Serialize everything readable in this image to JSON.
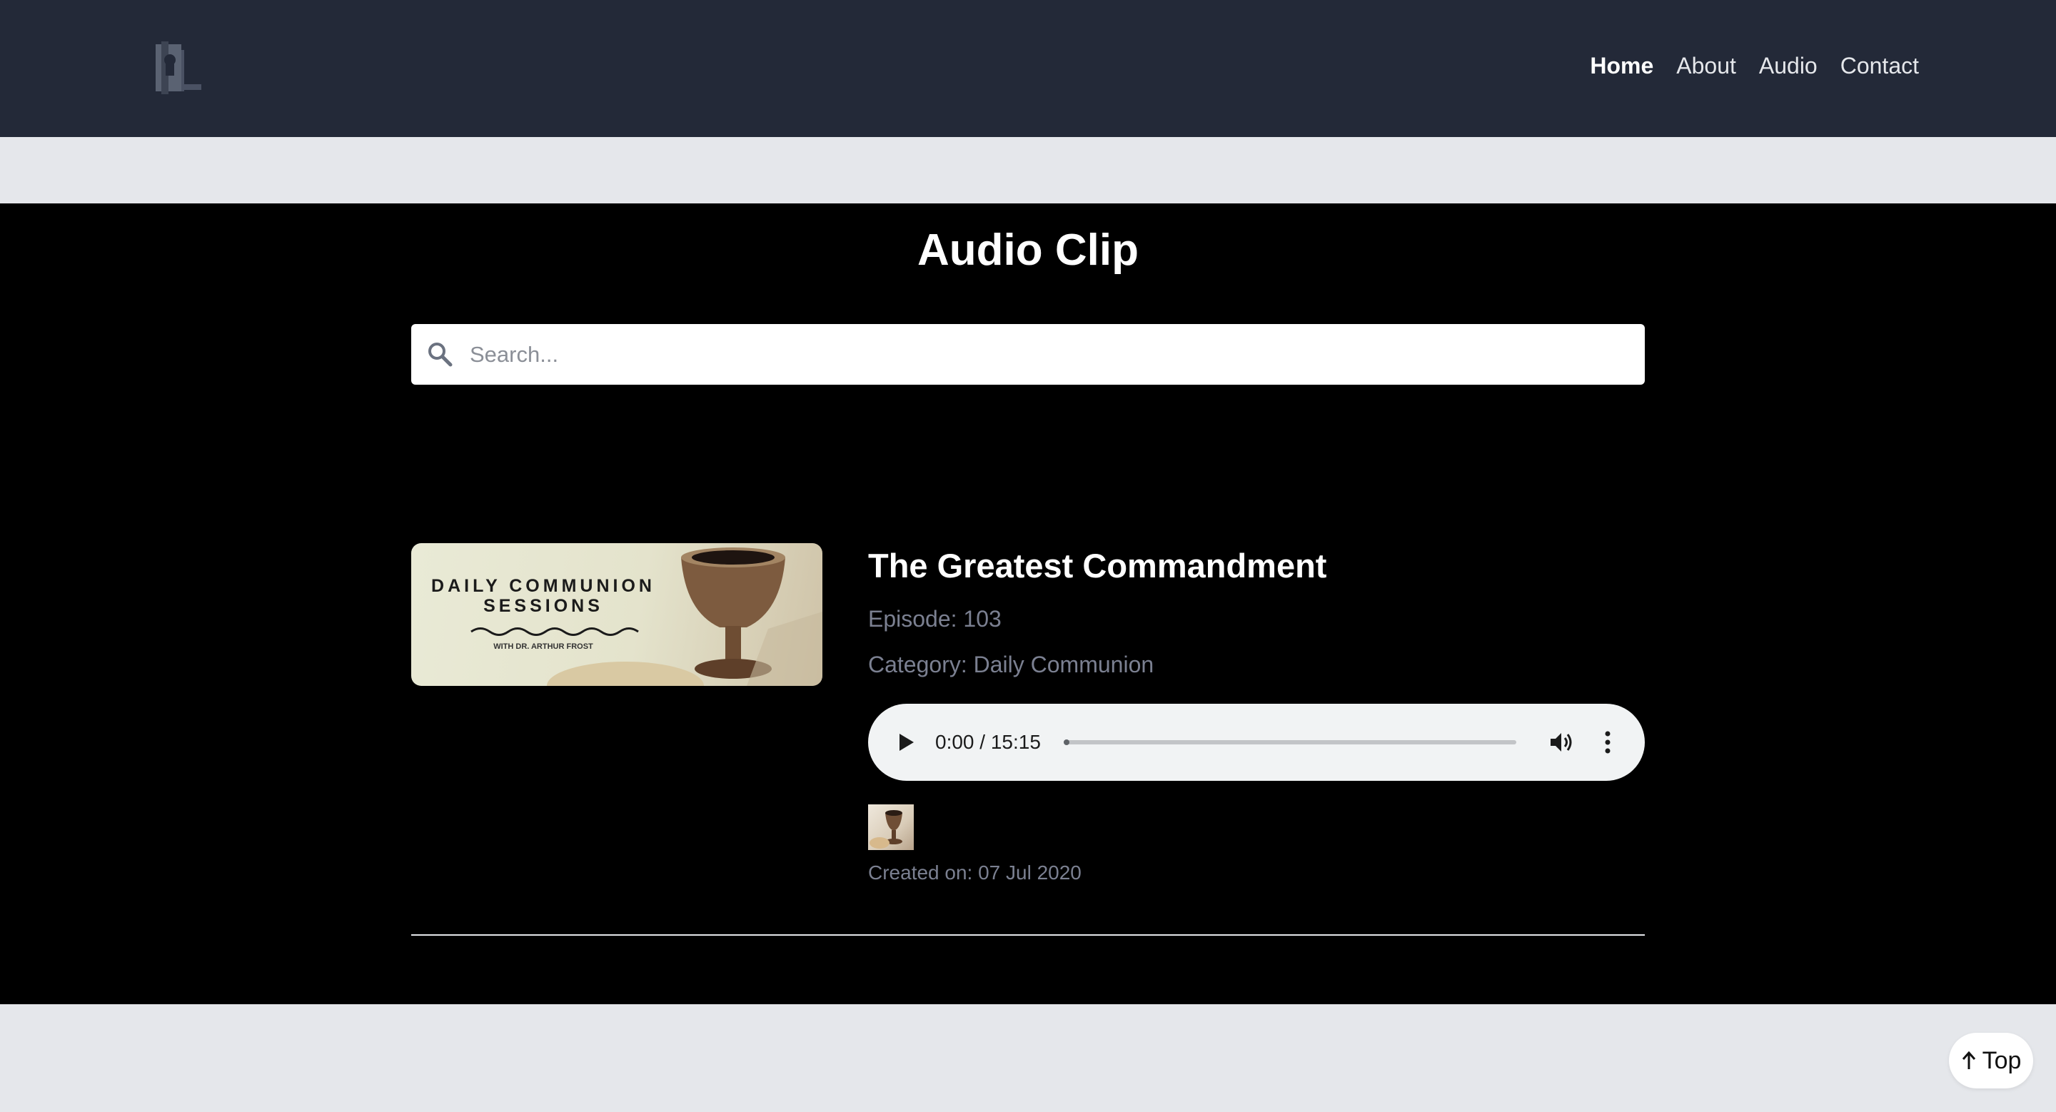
{
  "nav": {
    "logo_icon": "site-logo",
    "links": [
      {
        "label": "Home",
        "active": true
      },
      {
        "label": "About",
        "active": false
      },
      {
        "label": "Audio",
        "active": false
      },
      {
        "label": "Contact",
        "active": false
      }
    ]
  },
  "page": {
    "title": "Audio Clip"
  },
  "search": {
    "placeholder": "Search...",
    "value": ""
  },
  "episode": {
    "title": "The Greatest Commandment",
    "episode": "Episode: 103",
    "category": "Category: Daily Communion",
    "thumbnail": {
      "line1": "DAILY COMMUNION",
      "line2": "SESSIONS",
      "line3": "WITH DR. ARTHUR FROST"
    },
    "created": "Created on: 07 Jul 2020"
  },
  "player": {
    "time": "0:00 / 15:15",
    "progress": 0
  },
  "scroll_top": {
    "label": "Top"
  },
  "colors": {
    "navbar": "#232938",
    "main_bg": "#000000",
    "page_bg": "#e5e7eb",
    "muted_text": "#7b8091"
  }
}
